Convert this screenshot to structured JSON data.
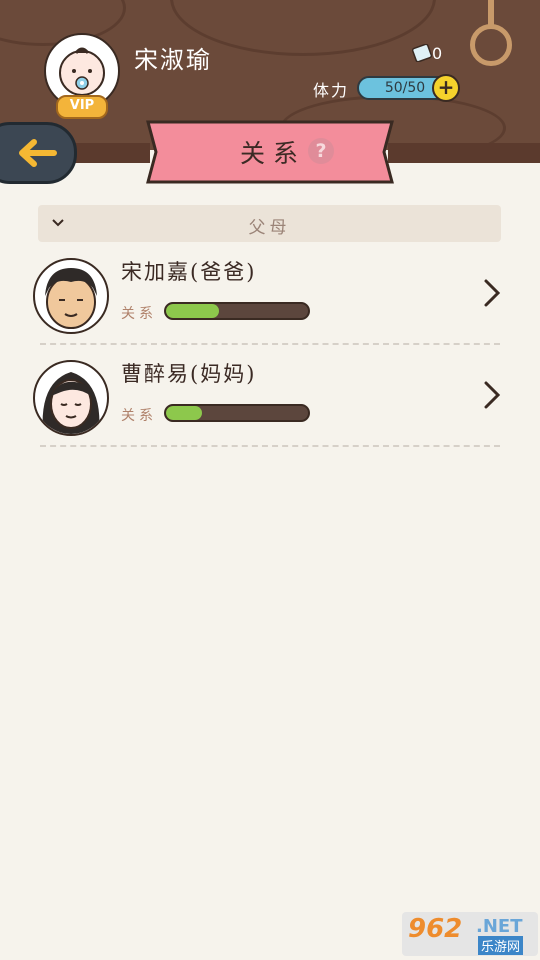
{
  "profile": {
    "name": "宋淑瑜",
    "vip_label": "VIP",
    "ticket_count": "0",
    "stamina_label": "体力",
    "stamina_value": "50/50"
  },
  "page": {
    "title": "关系",
    "help_symbol": "?"
  },
  "section": {
    "title": "父母"
  },
  "people": [
    {
      "name": "宋加嘉(爸爸)",
      "relation_label": "关系",
      "relation_level": 0.37
    },
    {
      "name": "曹醉易(妈妈)",
      "relation_label": "关系",
      "relation_level": 0.25
    }
  ],
  "watermark": {
    "number": "962",
    "domain": ".NET",
    "site": "乐游网"
  },
  "colors": {
    "wood": "#6b4a3a",
    "banner": "#f38d9b",
    "relation_fill": "#8dc84c",
    "stamina": "#6cc2de"
  }
}
